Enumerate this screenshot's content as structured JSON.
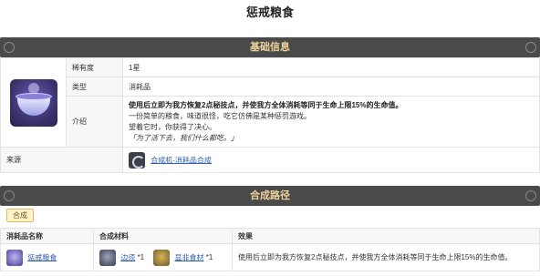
{
  "page": {
    "title": "惩戒粮食"
  },
  "basic": {
    "header": "基础信息",
    "rows": [
      {
        "label": "稀有度",
        "value": "1星"
      },
      {
        "label": "类型",
        "value": "消耗品"
      }
    ],
    "intro_label": "介绍",
    "intro": {
      "bold": "使用后立即为我方恢复2点秘技点，并使我方全体消耗等同于生命上限15%的生命值。",
      "line1": "一份简单的粮食，味道很怪，吃它仿佛是某种惩罚游戏。",
      "line2": "望着它时，你获得了决心。",
      "quote": "「为了活下去，我们什么都吃。」"
    },
    "source_label": "来源",
    "source_link": "合成机-消耗品合成",
    "icon": "consumable-bowl-icon"
  },
  "craft": {
    "header": "合成路径",
    "tab": "合成",
    "columns": [
      "消耗品名称",
      "合成材料",
      "效果"
    ],
    "rows": [
      {
        "name": "惩戒粮食",
        "materials": [
          {
            "name": "边须",
            "qty": "*1"
          },
          {
            "name": "显非食材",
            "qty": "*1"
          }
        ],
        "effect": "使用后立即为我方恢复2点秘技点，并使我方全体消耗等同于生命上限15%的生命值。"
      }
    ]
  },
  "colors": {
    "header_bar": "#4a4a4a",
    "header_text": "#f0d39a",
    "link": "#2f5fb5",
    "tab_bg": "#fff3c8"
  }
}
